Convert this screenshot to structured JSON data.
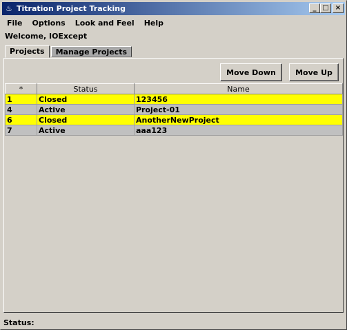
{
  "window": {
    "title": "Titration Project Tracking",
    "controls": {
      "minimize": "_",
      "maximize": "□",
      "close": "×"
    }
  },
  "menu": [
    "File",
    "Options",
    "Look and Feel",
    "Help"
  ],
  "welcome": "Welcome,  IOExcept",
  "tabs": [
    {
      "label": "Projects",
      "active": false
    },
    {
      "label": "Manage Projects",
      "active": true
    }
  ],
  "toolbar": {
    "move_down": "Move Down",
    "move_up": "Move Up"
  },
  "table": {
    "columns": [
      "*",
      "Status",
      "Name"
    ],
    "rows": [
      {
        "id": "1",
        "status": "Closed",
        "name": "123456"
      },
      {
        "id": "4",
        "status": "Active",
        "name": "Project-01"
      },
      {
        "id": "6",
        "status": "Closed",
        "name": "AnotherNewProject"
      },
      {
        "id": "7",
        "status": "Active",
        "name": "aaa123"
      }
    ]
  },
  "status_bar": "Status:",
  "colors": {
    "closed_row": "#ffff00",
    "active_row": "#c0c0c0",
    "titlebar": "#0a246a"
  }
}
